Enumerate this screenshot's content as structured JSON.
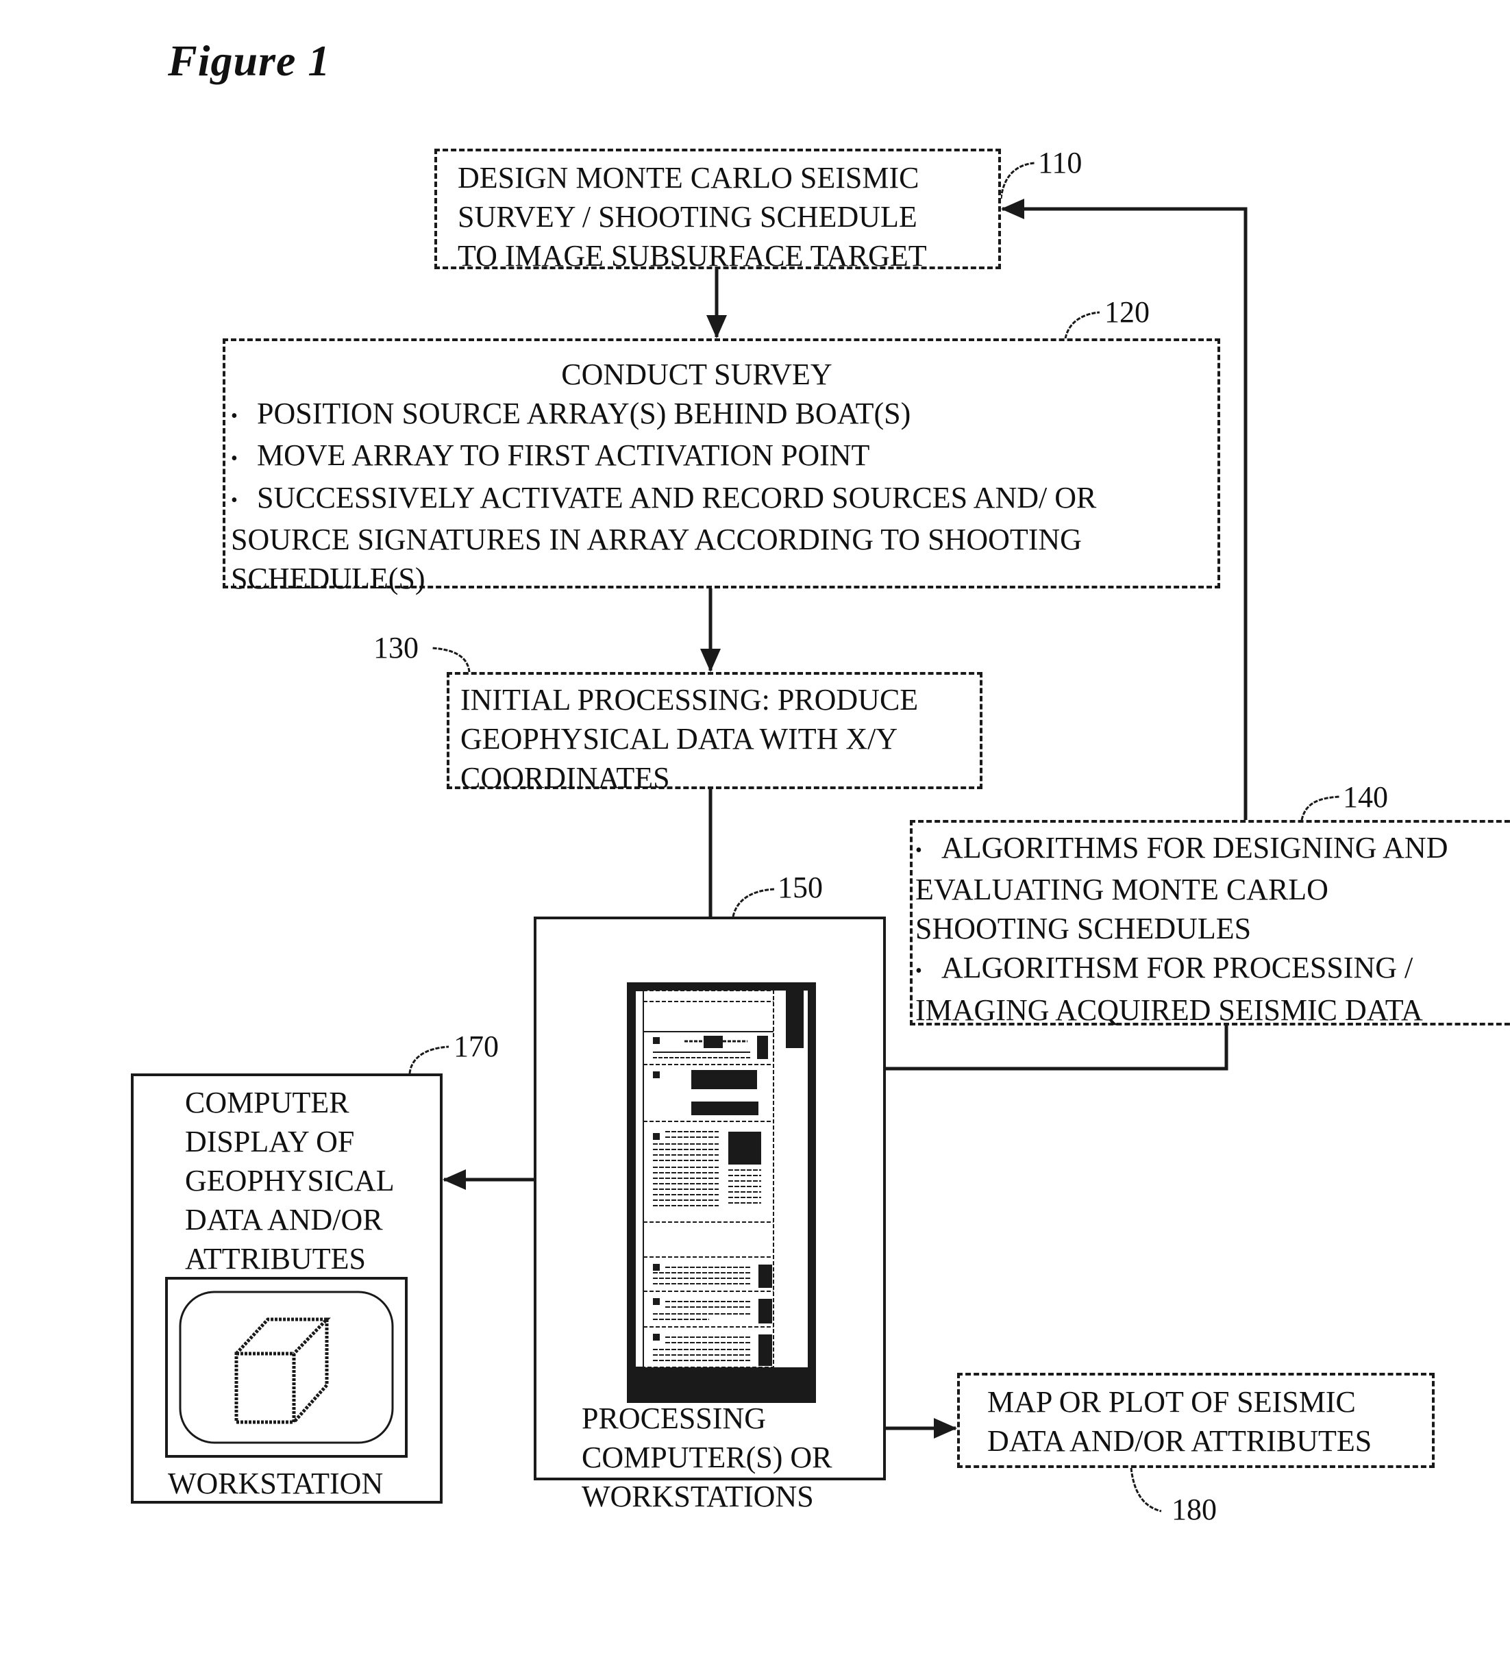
{
  "figure": {
    "title": "Figure 1"
  },
  "boxes": {
    "b110": {
      "ref": "110",
      "lines": [
        "DESIGN MONTE CARLO SEISMIC",
        "SURVEY / SHOOTING SCHEDULE",
        "TO IMAGE SUBSURFACE TARGET"
      ]
    },
    "b120": {
      "ref": "120",
      "heading": "CONDUCT SURVEY",
      "bullets": [
        "POSITION SOURCE ARRAY(S) BEHIND BOAT(S)",
        "MOVE ARRAY TO FIRST ACTIVATION POINT",
        "SUCCESSIVELY ACTIVATE AND RECORD SOURCES AND/ OR"
      ],
      "continuation": [
        "SOURCE SIGNATURES IN ARRAY ACCORDING TO SHOOTING",
        "SCHEDULE(S)"
      ]
    },
    "b130": {
      "ref": "130",
      "lines": [
        "INITIAL PROCESSING:  PRODUCE",
        "GEOPHYSICAL DATA WITH X/Y",
        "COORDINATES"
      ]
    },
    "b140": {
      "ref": "140",
      "bullet1": "ALGORITHMS FOR DESIGNING AND",
      "bullet1_cont": [
        "EVALUATING MONTE CARLO",
        "SHOOTING SCHEDULES"
      ],
      "bullet2": "ALGORITHSM FOR PROCESSING /",
      "bullet2_cont": [
        "IMAGING ACQUIRED SEISMIC DATA"
      ]
    },
    "b150": {
      "ref": "150",
      "caption": [
        "PROCESSING",
        "COMPUTER(S) OR",
        "WORKSTATIONS"
      ],
      "icon": "server-rack-icon"
    },
    "b170": {
      "ref": "170",
      "lines": [
        "COMPUTER",
        "DISPLAY OF",
        "GEOPHYSICAL",
        "DATA AND/OR",
        "ATTRIBUTES"
      ],
      "caption": "WORKSTATION",
      "icon": "monitor-cube-icon"
    },
    "b180": {
      "ref": "180",
      "lines": [
        "MAP OR PLOT OF SEISMIC",
        "DATA AND/OR ATTRIBUTES"
      ]
    }
  },
  "connections": [
    {
      "from": "110",
      "to": "120",
      "type": "arrow"
    },
    {
      "from": "120",
      "to": "130",
      "type": "arrow"
    },
    {
      "from": "130",
      "to": "150",
      "type": "arrow"
    },
    {
      "from": "140",
      "to": "110",
      "type": "arrow"
    },
    {
      "from": "140",
      "to": "150",
      "type": "arrow"
    },
    {
      "from": "170",
      "to": "150",
      "type": "bidirectional"
    },
    {
      "from": "150",
      "to": "180",
      "type": "arrow"
    }
  ]
}
